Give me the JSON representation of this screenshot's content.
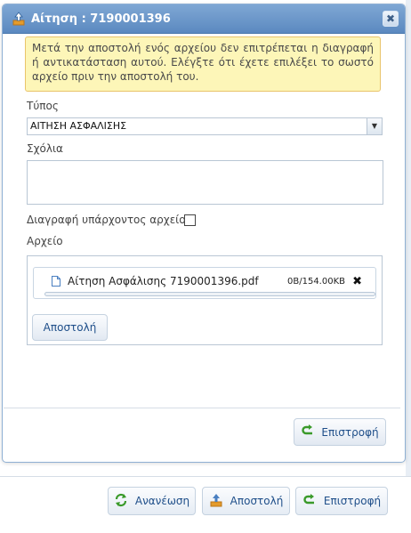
{
  "dialog": {
    "title": "Αίτηση : 7190001396",
    "close_label": "✖",
    "warning_text": "Μετά την αποστολή ενός αρχείου δεν επιτρέπεται η διαγραφή ή αντικατάσταση αυτού. Ελέγξτε ότι έχετε επιλέξει το σωστό αρχείο πριν την αποστολή του.",
    "type_label": "Τύπος",
    "type_value": "ΑΙΤΗΣΗ ΑΣΦΑΛΙΣΗΣ",
    "comments_label": "Σχόλια",
    "comments_value": "",
    "delete_existing_label": "Διαγραφή υπάρχοντος αρχείου",
    "delete_existing_checked": false,
    "file_label": "Αρχείο",
    "file": {
      "name": "Αίτηση Ασφάλισης 7190001396.pdf",
      "size": "0B/154.00KB",
      "progress": 0.0
    },
    "send_button": "Αποστολή",
    "return_button": "Επιστροφή"
  },
  "footer": {
    "refresh_button": "Ανανέωση",
    "send_button": "Αποστολή",
    "return_button": "Επιστροφή"
  },
  "colors": {
    "titlebar": "#5b89c0",
    "warning_bg": "#fdf6b8",
    "button_text": "#1f4f8a",
    "green_icon": "#3a9a2a"
  }
}
